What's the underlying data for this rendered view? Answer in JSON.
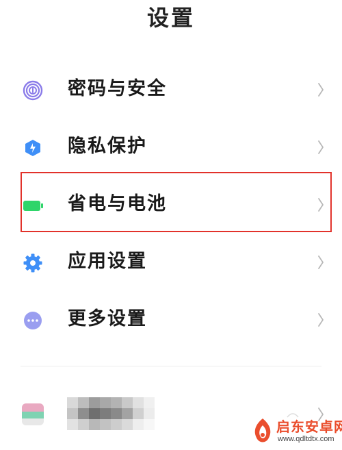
{
  "header": {
    "title": "设置"
  },
  "menu": {
    "items": [
      {
        "label": "密码与安全",
        "icon": "fingerprint-icon"
      },
      {
        "label": "隐私保护",
        "icon": "privacy-shield-icon"
      },
      {
        "label": "省电与电池",
        "icon": "battery-icon"
      },
      {
        "label": "应用设置",
        "icon": "gear-icon"
      },
      {
        "label": "更多设置",
        "icon": "more-dots-icon"
      }
    ]
  },
  "watermark": {
    "text": "启东安卓网",
    "url": "www.qdltdtx.com"
  },
  "colors": {
    "accent_blue": "#3f8ff7",
    "battery_green": "#2fd56a",
    "highlight_red": "#e2322b",
    "fingerprint_purple": "#8a7be9"
  }
}
